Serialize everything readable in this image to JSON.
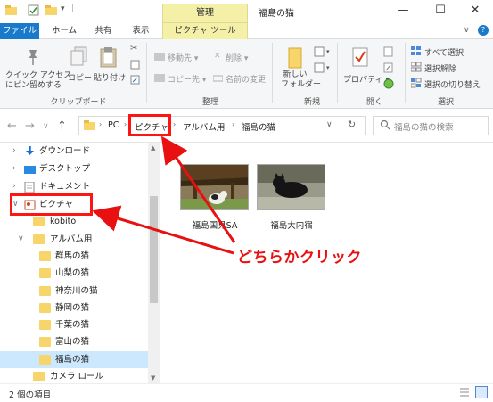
{
  "window": {
    "title": "福島の猫",
    "context_tab_head": "管理",
    "minimize": "—",
    "maximize": "☐",
    "close": "✕"
  },
  "ribbon_tabs": [
    "ファイル",
    "ホーム",
    "共有",
    "表示",
    "ピクチャ ツール"
  ],
  "ribbon": {
    "clipboard": {
      "pin": "クイック アクセス\nにピン留めする",
      "pin_l1": "クイック アクセス",
      "pin_l2": "にピン留めする",
      "copy": "コピー",
      "paste": "貼り付け",
      "group": "クリップボード"
    },
    "organize": {
      "move_to": "移動先",
      "copy_to": "コピー先",
      "delete": "削除",
      "rename": "名前の変更",
      "group": "整理"
    },
    "new": {
      "new_folder_l1": "新しい",
      "new_folder_l2": "フォルダー",
      "group": "新規"
    },
    "open": {
      "properties": "プロパティ",
      "group": "開く"
    },
    "select": {
      "select_all": "すべて選択",
      "select_none": "選択解除",
      "invert": "選択の切り替え",
      "group": "選択"
    }
  },
  "address": {
    "crumbs": [
      "PC",
      "ピクチャ",
      "アルバム用",
      "福島の猫"
    ],
    "search_placeholder": "福島の猫の検索"
  },
  "sidebar": {
    "items": [
      {
        "label": "ダウンロード",
        "icon": "download-icon",
        "expander": "›"
      },
      {
        "label": "デスクトップ",
        "icon": "desktop-icon",
        "expander": "›"
      },
      {
        "label": "ドキュメント",
        "icon": "documents-icon",
        "expander": "›"
      },
      {
        "label": "ピクチャ",
        "icon": "pictures-icon",
        "expander": "∨"
      },
      {
        "label": "kobito",
        "icon": "folder-icon",
        "expander": ""
      },
      {
        "label": "アルバム用",
        "icon": "folder-icon",
        "expander": "∨"
      },
      {
        "label": "群馬の猫",
        "icon": "folder-icon",
        "expander": ""
      },
      {
        "label": "山梨の猫",
        "icon": "folder-icon",
        "expander": ""
      },
      {
        "label": "神奈川の猫",
        "icon": "folder-icon",
        "expander": ""
      },
      {
        "label": "静岡の猫",
        "icon": "folder-icon",
        "expander": ""
      },
      {
        "label": "千葉の猫",
        "icon": "folder-icon",
        "expander": ""
      },
      {
        "label": "富山の猫",
        "icon": "folder-icon",
        "expander": ""
      },
      {
        "label": "福島の猫",
        "icon": "folder-icon",
        "expander": ""
      },
      {
        "label": "カメラ ロール",
        "icon": "folder-icon",
        "expander": ""
      }
    ],
    "selected": "福島の猫"
  },
  "files": [
    {
      "name": "福島国見SA"
    },
    {
      "name": "福島大内宿"
    }
  ],
  "status": {
    "count": "2 個の項目"
  },
  "annotation": {
    "label": "どちらかクリック",
    "color": "#e81010"
  }
}
